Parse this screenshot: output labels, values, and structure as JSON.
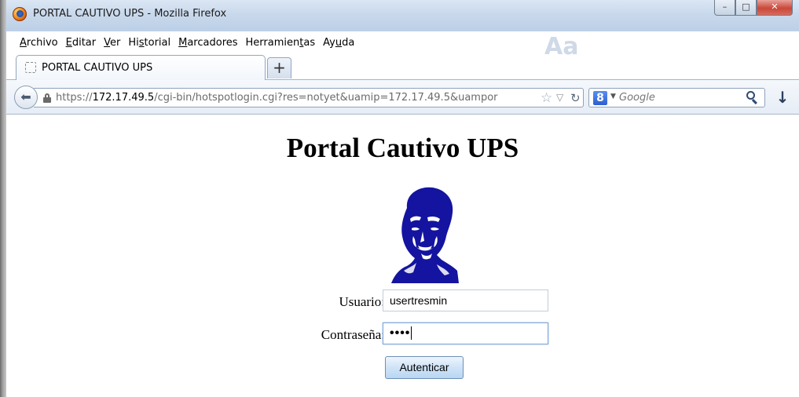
{
  "window": {
    "title": "PORTAL CAUTIVO UPS - Mozilla Firefox",
    "minimize_label": "–",
    "maximize_label": "□",
    "close_label": "✕"
  },
  "menu": [
    {
      "first": "A",
      "rest": "rchivo"
    },
    {
      "first": "E",
      "rest": "ditar"
    },
    {
      "first": "V",
      "rest": "er"
    },
    {
      "first": "",
      "pre": "Hi",
      "ul": "s",
      "post": "torial"
    },
    {
      "first": "M",
      "rest": "arcadores"
    },
    {
      "first": "",
      "pre": "Herramien",
      "ul": "t",
      "post": "as"
    },
    {
      "first": "",
      "pre": "Ay",
      "ul": "u",
      "post": "da"
    }
  ],
  "tabs": [
    {
      "label": "PORTAL CAUTIVO UPS"
    }
  ],
  "new_tab_label": "+",
  "address": {
    "scheme": "https://",
    "host": "172.17.49.5",
    "path": "/cgi-bin/hotspotlogin.cgi?res=notyet&uamip=172.17.49.5&uampor"
  },
  "search": {
    "engine_letter": "8",
    "placeholder": "Google"
  },
  "page": {
    "title": "Portal Cautivo UPS",
    "username_label": "Usuario:",
    "username_value": "usertresmin",
    "password_label": "Contraseña:",
    "password_masked": "••••",
    "submit_label": "Autenticar"
  },
  "colors": {
    "portrait": "#1414a0",
    "chrome": "#c9d9ec"
  }
}
